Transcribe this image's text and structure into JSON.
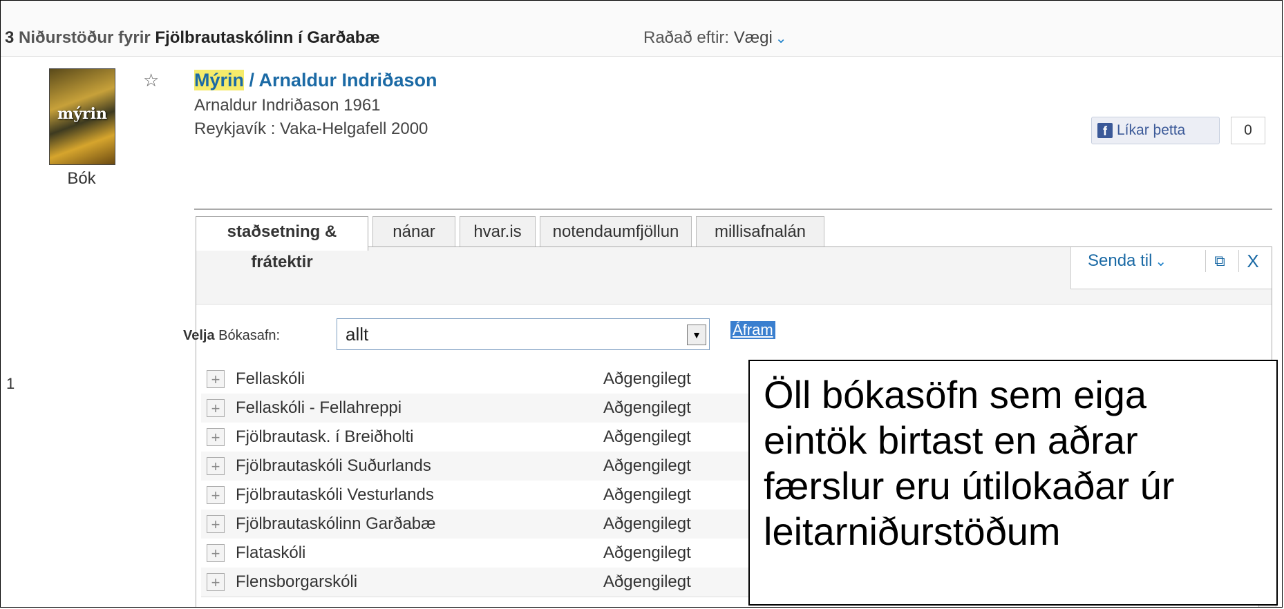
{
  "results": {
    "count": "3",
    "prefix": "Niðurstöður fyrir",
    "term": "Fjölbrautaskólinn í Garðabæ",
    "sort_label": "Raðað eftir:",
    "sort_value": "Vægi"
  },
  "record": {
    "number": "1",
    "cover_text": "mýrin",
    "type": "Bók",
    "title_highlight": "Mýrin",
    "title_rest": " / Arnaldur Indriðason",
    "author_line": "Arnaldur Indriðason 1961",
    "publisher_line": "Reykjavík : Vaka-Helgafell 2000",
    "like_label": "Líkar þetta",
    "like_count": "0"
  },
  "tabs": [
    {
      "label": "staðsetning & frátektir"
    },
    {
      "label": "nánar"
    },
    {
      "label": "hvar.is"
    },
    {
      "label": "notendaumfjöllun"
    },
    {
      "label": "millisafnalán"
    }
  ],
  "panel": {
    "send_to": "Senda til",
    "close": "X",
    "library_label_bold": "Velja",
    "library_label": " Bókasafn:",
    "library_value": "allt",
    "go_label": "Áfram"
  },
  "libraries": [
    {
      "name": "Fellaskóli",
      "status": "Aðgengilegt"
    },
    {
      "name": "Fellaskóli - Fellahreppi",
      "status": "Aðgengilegt"
    },
    {
      "name": "Fjölbrautask. í Breiðholti",
      "status": "Aðgengilegt"
    },
    {
      "name": "Fjölbrautaskóli Suðurlands",
      "status": "Aðgengilegt"
    },
    {
      "name": "Fjölbrautaskóli Vesturlands",
      "status": "Aðgengilegt"
    },
    {
      "name": "Fjölbrautaskólinn Garðabæ",
      "status": "Aðgengilegt"
    },
    {
      "name": "Flataskóli",
      "status": "Aðgengilegt"
    },
    {
      "name": "Flensborgarskóli",
      "status": "Aðgengilegt"
    }
  ],
  "callout": {
    "lines": [
      "Öll bókasöfn sem eiga",
      "eintök birtast en aðrar",
      "færslur eru útilokaðar úr",
      "leitarniðurstöðum"
    ]
  }
}
